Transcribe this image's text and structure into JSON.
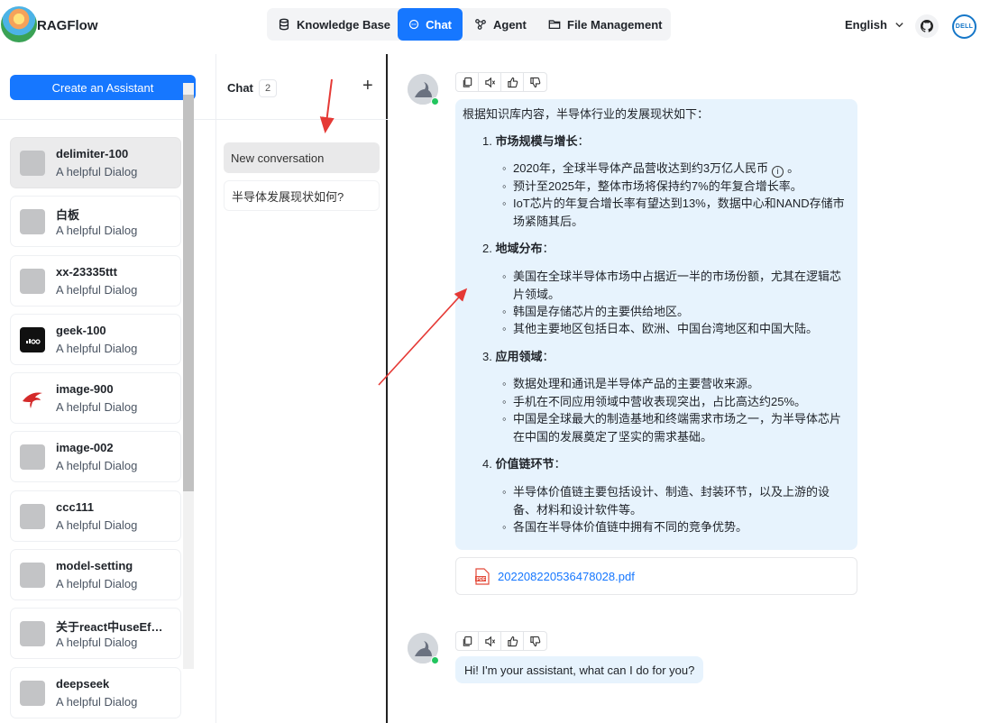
{
  "app": {
    "title": "RAGFlow"
  },
  "nav": {
    "items": [
      {
        "label": "Knowledge Base",
        "icon": "database-icon",
        "active": false
      },
      {
        "label": "Chat",
        "icon": "chat-bubble-icon",
        "active": true
      },
      {
        "label": "Agent",
        "icon": "agent-graph-icon",
        "active": false
      },
      {
        "label": "File Management",
        "icon": "folder-icon",
        "active": false
      }
    ]
  },
  "header": {
    "language": "English",
    "github_icon": "github-icon",
    "user_avatar_text": "DELL"
  },
  "sidebar": {
    "create_label": "Create an Assistant",
    "assistants": [
      {
        "name": "delimiter-100",
        "desc": "A helpful Dialog",
        "avatar": "gray",
        "selected": true
      },
      {
        "name": "白板",
        "desc": "A helpful Dialog",
        "avatar": "gray"
      },
      {
        "name": "xx-23335ttt",
        "desc": "A helpful Dialog",
        "avatar": "gray"
      },
      {
        "name": "geek-100",
        "desc": "A helpful Dialog",
        "avatar": "dark-logo"
      },
      {
        "name": "image-900",
        "desc": "A helpful Dialog",
        "avatar": "red-bird"
      },
      {
        "name": "image-002",
        "desc": "A helpful Dialog",
        "avatar": "gray"
      },
      {
        "name": "ccc111",
        "desc": "A helpful Dialog",
        "avatar": "gray"
      },
      {
        "name": "model-setting",
        "desc": "A helpful Dialog",
        "avatar": "gray"
      },
      {
        "name": "关于react中useEf…",
        "desc": "A helpful Dialog",
        "avatar": "gray"
      },
      {
        "name": "deepseek",
        "desc": "A helpful Dialog",
        "avatar": "gray"
      }
    ]
  },
  "chat": {
    "title": "Chat",
    "count": "2",
    "conversations": [
      {
        "label": "New conversation",
        "selected": true
      },
      {
        "label": "半导体发展现状如何?",
        "selected": false
      }
    ]
  },
  "message1": {
    "intro": "根据知识库内容，半导体行业的发展现状如下：",
    "sections": [
      {
        "num": "1.",
        "title": "市场规模与增长",
        "colon": "：",
        "bullets": [
          "2020年，全球半导体产品营收达到约3万亿人民币",
          "预计至2025年，整体市场将保持约7%的年复合增长率。",
          "IoT芯片的年复合增长率有望达到13%，数据中心和NAND存储市场紧随其后。"
        ]
      },
      {
        "num": "2.",
        "title": "地域分布",
        "colon": "：",
        "bullets": [
          "美国在全球半导体市场中占据近一半的市场份额，尤其在逻辑芯片领域。",
          "韩国是存储芯片的主要供给地区。",
          "其他主要地区包括日本、欧洲、中国台湾地区和中国大陆。"
        ]
      },
      {
        "num": "3.",
        "title": "应用领域",
        "colon": "：",
        "bullets": [
          "数据处理和通讯是半导体产品的主要营收来源。",
          "手机在不同应用领域中营收表现突出，占比高达约25%。",
          "中国是全球最大的制造基地和终端需求市场之一，为半导体芯片在中国的发展奠定了坚实的需求基础。"
        ]
      },
      {
        "num": "4.",
        "title": "价值链环节",
        "colon": "：",
        "bullets": [
          "半导体价值链主要包括设计、制造、封装环节，以及上游的设备、材料和设计软件等。",
          "各国在半导体价值链中拥有不同的竞争优势。"
        ]
      }
    ],
    "first_bullet_suffix": "。",
    "attachment": "202208220536478028.pdf",
    "pdf_badge": "PDF"
  },
  "message2": {
    "text": "Hi! I'm your assistant, what can I do for you?"
  },
  "colors": {
    "accent": "#1677ff",
    "bubble": "#e7f3fd",
    "annotation_arrow": "#e53935",
    "online": "#22c55e"
  }
}
